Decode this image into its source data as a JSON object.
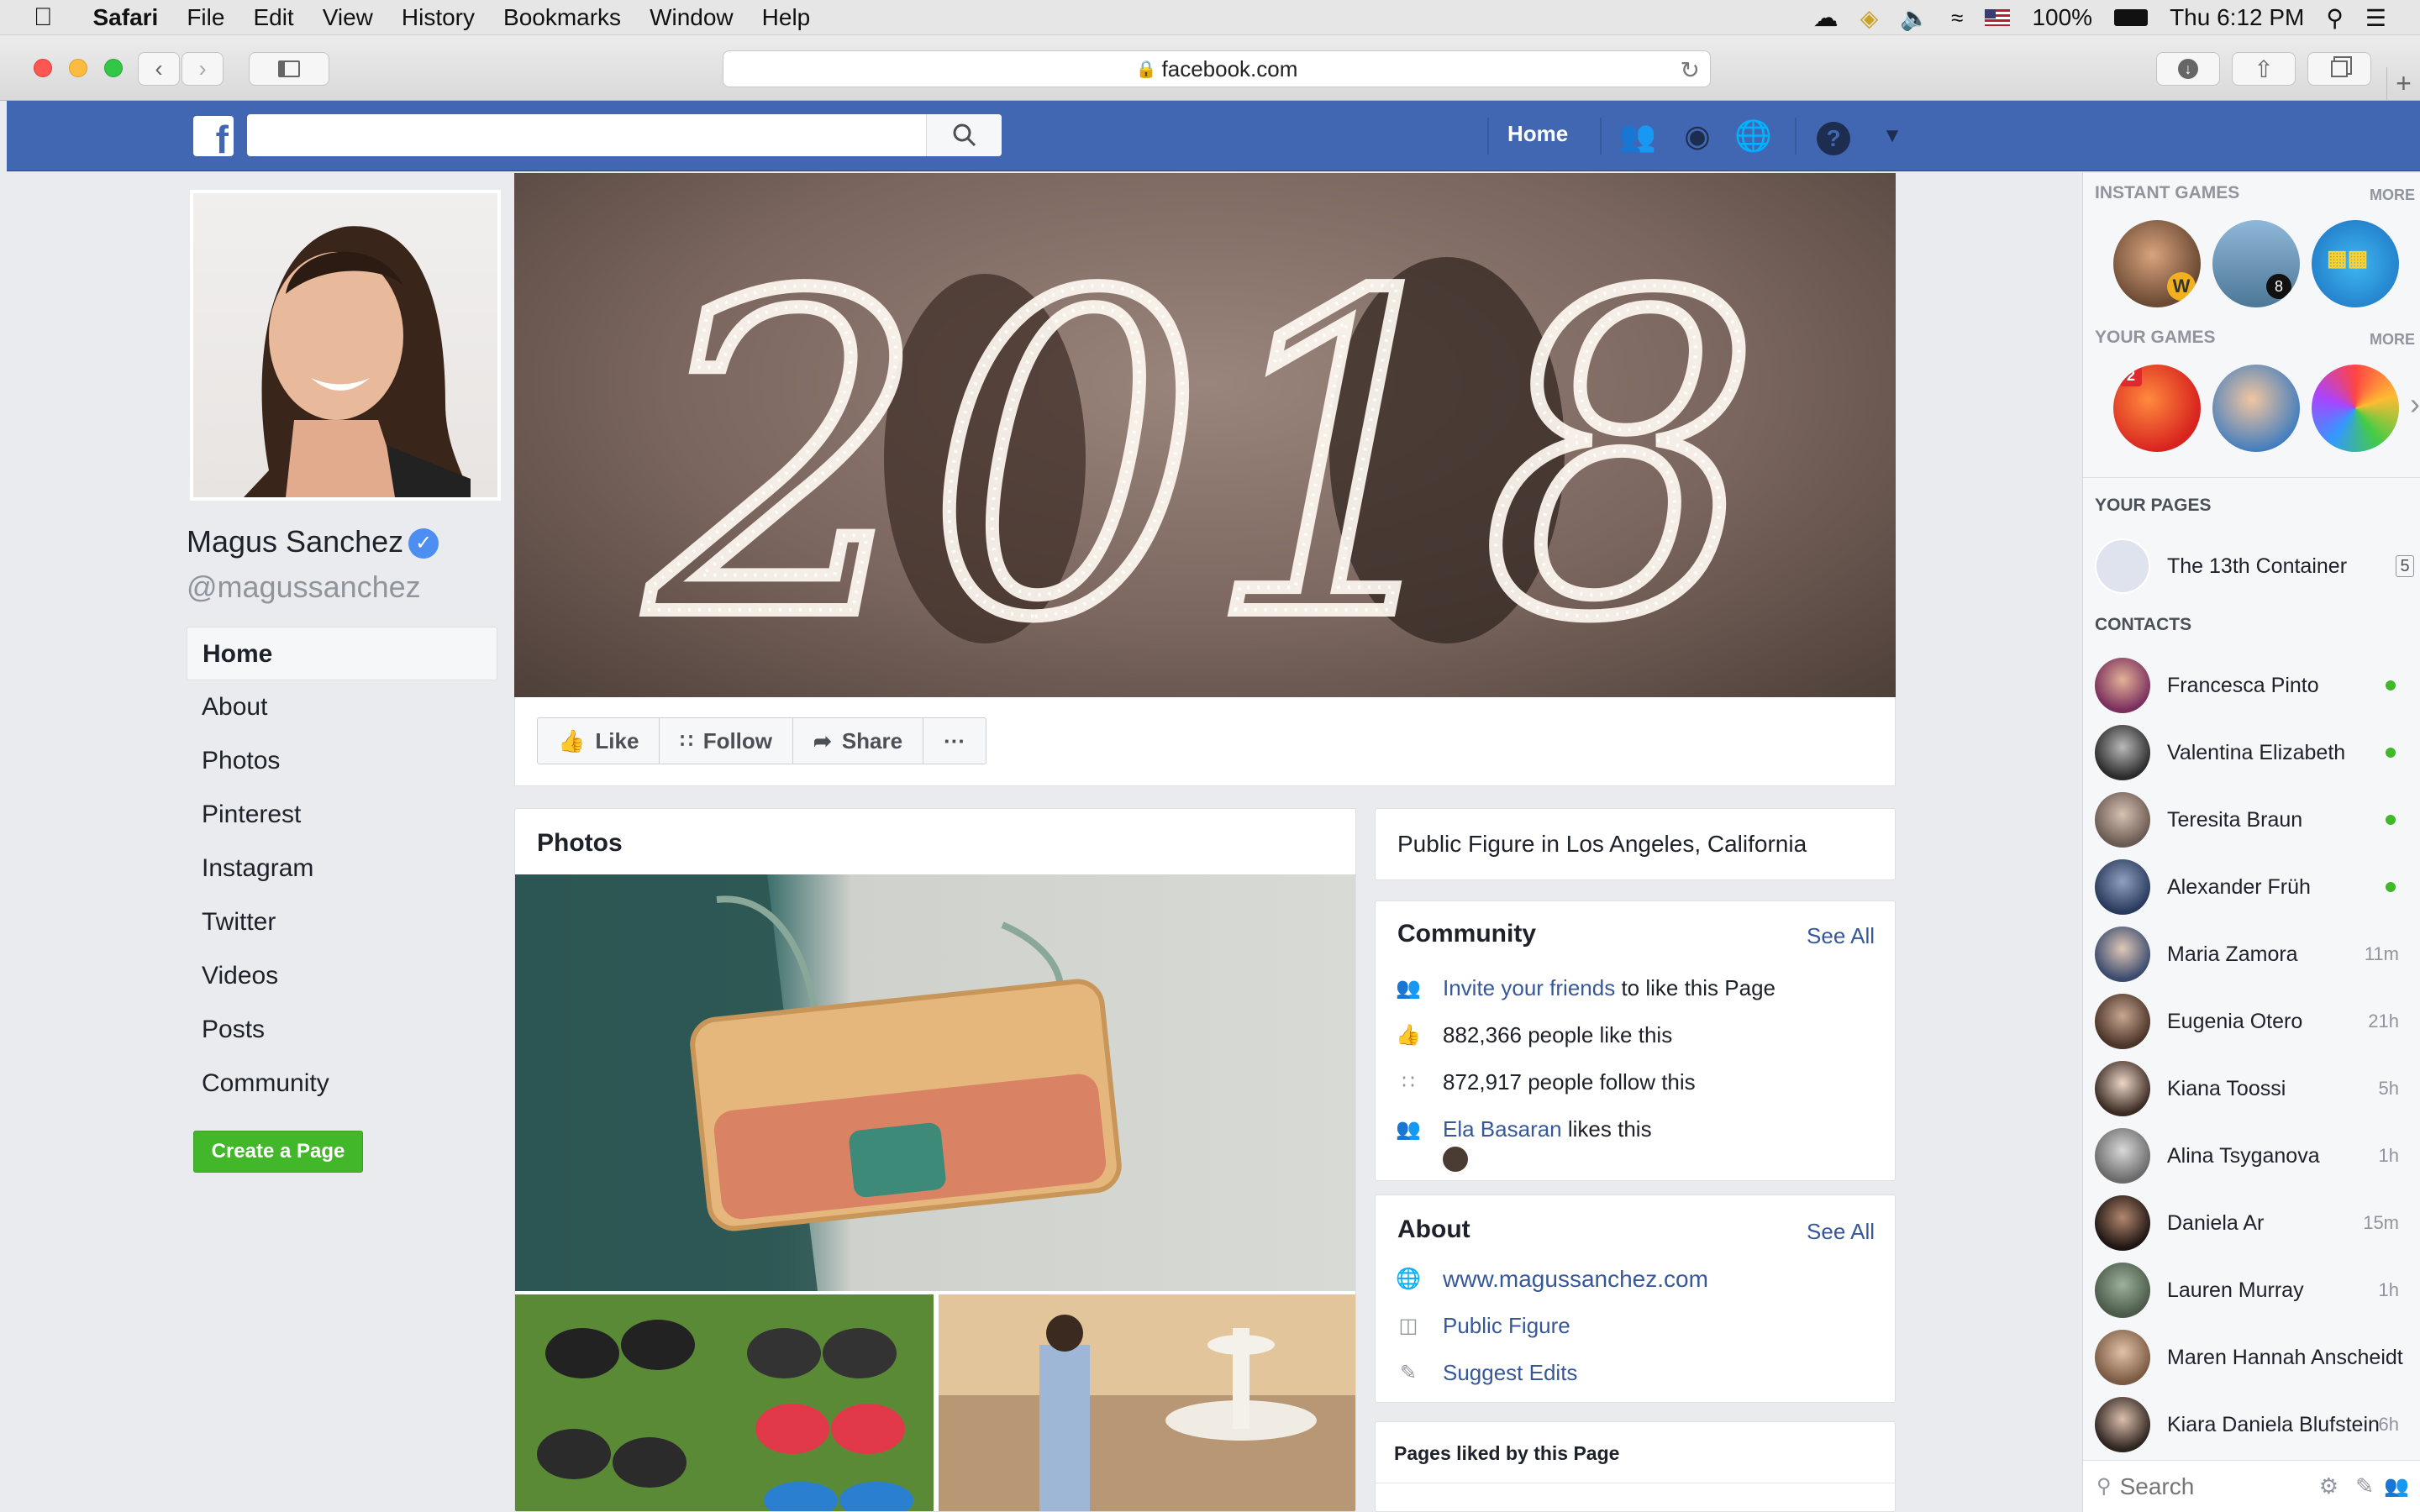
{
  "menubar": {
    "app": "Safari",
    "items": [
      "File",
      "Edit",
      "View",
      "History",
      "Bookmarks",
      "Window",
      "Help"
    ],
    "battery": "100%",
    "clock": "Thu 6:12 PM"
  },
  "browser": {
    "url": "facebook.com"
  },
  "fb_nav": {
    "home": "Home"
  },
  "profile": {
    "name": "Magus Sanchez",
    "handle": "@magussanchez",
    "nav": [
      "Home",
      "About",
      "Photos",
      "Pinterest",
      "Instagram",
      "Twitter",
      "Videos",
      "Posts",
      "Community"
    ],
    "create_page": "Create a Page"
  },
  "cover_text": "2018",
  "actions": {
    "like": "Like",
    "follow": "Follow",
    "share": "Share",
    "more": "···"
  },
  "photos": {
    "title": "Photos"
  },
  "page_info": {
    "category": "Public Figure in Los Angeles, California"
  },
  "community": {
    "title": "Community",
    "see_all": "See All",
    "invite_link": "Invite your friends",
    "invite_rest": " to like this Page",
    "likes": "882,366 people like this",
    "follows": "872,917 people follow this",
    "friend_link": "Ela Basaran",
    "friend_rest": " likes this"
  },
  "about": {
    "title": "About",
    "see_all": "See All",
    "website": "www.magussanchez.com",
    "category": "Public Figure",
    "suggest": "Suggest Edits"
  },
  "pages_liked": {
    "title": "Pages liked by this Page"
  },
  "sidebar": {
    "instant_games": "INSTANT GAMES",
    "your_games": "YOUR GAMES",
    "more": "MORE",
    "your_pages": "YOUR PAGES",
    "page_name": "The 13th Container",
    "page_badge": "5",
    "candy_badge": "2",
    "contacts_title": "CONTACTS",
    "contacts": [
      {
        "name": "Francesca Pinto",
        "status": ""
      },
      {
        "name": "Valentina Elizabeth",
        "status": ""
      },
      {
        "name": "Teresita Braun",
        "status": ""
      },
      {
        "name": "Alexander Früh",
        "status": ""
      },
      {
        "name": "Maria Zamora",
        "status": "11m"
      },
      {
        "name": "Eugenia Otero",
        "status": "21h"
      },
      {
        "name": "Kiana Toossi",
        "status": "5h"
      },
      {
        "name": "Alina Tsyganova",
        "status": "1h"
      },
      {
        "name": "Daniela Ar",
        "status": "15m"
      },
      {
        "name": "Lauren Murray",
        "status": "1h"
      },
      {
        "name": "Maren Hannah Anscheidt",
        "status": ""
      },
      {
        "name": "Kiara Daniela Blufstein",
        "status": "6h"
      }
    ],
    "search_placeholder": "Search"
  },
  "colors": {
    "fb_blue": "#4267b2",
    "link": "#365899",
    "green": "#42b72a"
  }
}
